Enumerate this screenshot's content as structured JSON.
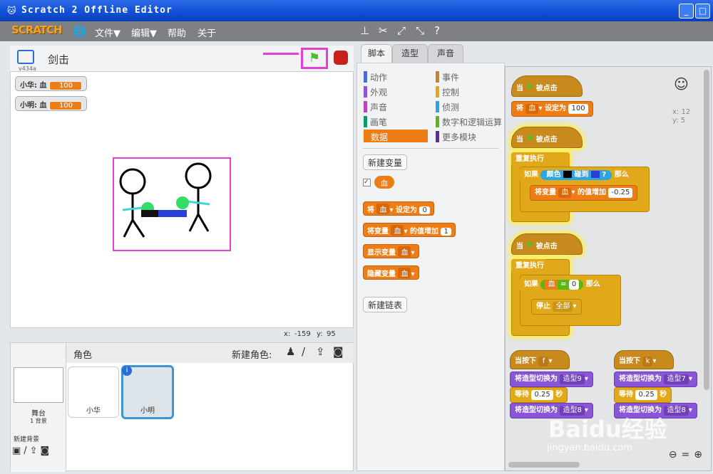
{
  "window": {
    "title": "Scratch 2 Offline Editor"
  },
  "menubar": {
    "logo": "SCRATCH",
    "items": [
      "文件▼",
      "编辑▼",
      "帮助",
      "关于"
    ]
  },
  "stage": {
    "version": "v434a",
    "project_title": "剑击",
    "coords": {
      "x_label": "x:",
      "x": "-159",
      "y_label": "y:",
      "y": "95"
    },
    "monitors": [
      {
        "label": "小华: 血",
        "value": "100"
      },
      {
        "label": "小明: 血",
        "value": "100"
      }
    ]
  },
  "sprites": {
    "header": "角色",
    "new_sprite_label": "新建角色:",
    "stage_label": "舞台",
    "backdrop_count": "1 背景",
    "new_backdrop": "新建背景",
    "items": [
      {
        "name": "小华"
      },
      {
        "name": "小明"
      }
    ]
  },
  "tabs": [
    "脚本",
    "造型",
    "声音"
  ],
  "categories": [
    {
      "label": "动作",
      "color": "#4a6cd4"
    },
    {
      "label": "事件",
      "color": "#c88330"
    },
    {
      "label": "外观",
      "color": "#8a55d7"
    },
    {
      "label": "控制",
      "color": "#e1a91a"
    },
    {
      "label": "声音",
      "color": "#bb42c3"
    },
    {
      "label": "侦测",
      "color": "#2ca5e2"
    },
    {
      "label": "画笔",
      "color": "#0e9a6c"
    },
    {
      "label": "数字和逻辑运算",
      "color": "#5cb712"
    },
    {
      "label": "数据",
      "color": "#ee7d16"
    },
    {
      "label": "更多模块",
      "color": "#632d99"
    }
  ],
  "palette": {
    "new_variable": "新建变量",
    "var_name": "血",
    "set_label": "将",
    "set_to": "设定为",
    "set_value": "0",
    "change_label": "将变量",
    "change_by": "的值增加",
    "change_value": "1",
    "show_var": "显示变量",
    "hide_var": "隐藏变量",
    "new_list": "新建链表"
  },
  "scripts": {
    "when_flag": "当",
    "clicked": "被点击",
    "set1": {
      "a": "将",
      "var": "血",
      "b": "设定为",
      "val": "100"
    },
    "forever": "重复执行",
    "if": "如果",
    "then": "那么",
    "touch": {
      "a": "颜色",
      "b": "碰到",
      "c": "?"
    },
    "change": {
      "a": "将变量",
      "var": "血",
      "b": "的值增加",
      "val": "-0.25"
    },
    "eq": {
      "left": "血",
      "op": "=",
      "right": "0"
    },
    "stop": {
      "a": "停止",
      "opt": "全部"
    },
    "key1": {
      "a": "当按下",
      "key": "f",
      "s1": "将造型切换为",
      "c1": "造型9",
      "wait": "等待",
      "secs": "0.25",
      "unit": "秒",
      "s2": "将造型切换为",
      "c2": "造型8"
    },
    "key2": {
      "a": "当按下",
      "key": "k",
      "s1": "将造型切换为",
      "c1": "造型7",
      "wait": "等待",
      "secs": "0.25",
      "unit": "秒",
      "s2": "将造型切换为",
      "c2": "造型8"
    },
    "sprite_x": "x: 12",
    "sprite_y": "y: 5"
  },
  "watermark": {
    "text": "Baidu经验",
    "url": "jingyan.baidu.com"
  }
}
